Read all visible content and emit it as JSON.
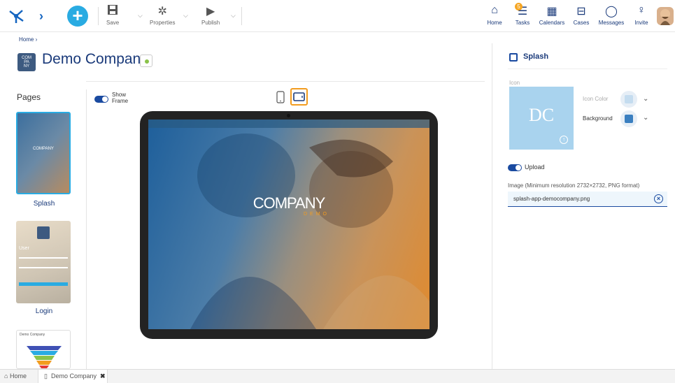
{
  "toolbar": {
    "save_label": "Save",
    "properties_label": "Properties",
    "publish_label": "Publish",
    "right_nav": [
      {
        "label": "Home",
        "icon": "home-icon"
      },
      {
        "label": "Tasks",
        "icon": "tasks-icon",
        "badge": "5"
      },
      {
        "label": "Calendars",
        "icon": "calendar-icon"
      },
      {
        "label": "Cases",
        "icon": "briefcase-icon"
      },
      {
        "label": "Messages",
        "icon": "message-icon"
      },
      {
        "label": "Invite",
        "icon": "invite-user-icon"
      }
    ]
  },
  "breadcrumb": "Home ›",
  "company": {
    "logo_text": "COMPANY",
    "logo_line1": "COM",
    "logo_line2": "PA",
    "logo_line3": "NY",
    "title": "Demo Company"
  },
  "pages": {
    "label": "Pages",
    "items": [
      {
        "label": "Splash"
      },
      {
        "label": "Login"
      }
    ],
    "login_thumb_user": "User",
    "third_thumb_title": "Demo Company"
  },
  "frame": {
    "show_frame_label_1": "Show",
    "show_frame_label_2": "Frame"
  },
  "preview": {
    "title": "COMPANY",
    "subtitle": "DEMO"
  },
  "panel": {
    "title": "Splash",
    "icon_label": "Icon",
    "icon_text": "DC",
    "icon_color_label": "Icon Color",
    "background_label": "Background",
    "upload_label": "Upload",
    "image_label": "Image (Minimum resolution 2732×2732, PNG format)",
    "image_file": "splash-app-democompany.png"
  },
  "bottom_tabs": {
    "home": "Home",
    "active": "Demo Company"
  },
  "colors": {
    "accent": "#1a4aa0",
    "highlight": "#f29c1f",
    "add_button": "#29abe2"
  }
}
